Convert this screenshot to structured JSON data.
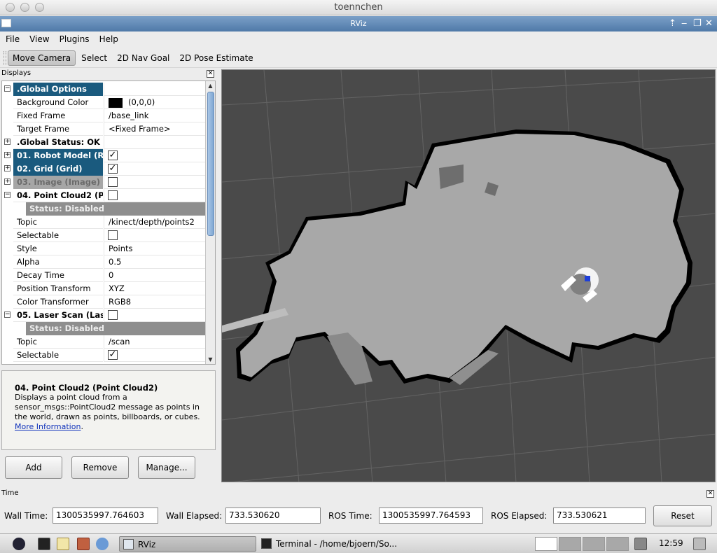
{
  "outer_window": {
    "title": "toennchen"
  },
  "window": {
    "title": "RViz"
  },
  "menu": [
    "File",
    "View",
    "Plugins",
    "Help"
  ],
  "toolbar": {
    "tools": [
      "Move Camera",
      "Select",
      "2D Nav Goal",
      "2D Pose Estimate"
    ],
    "active": "Move Camera"
  },
  "displays_panel": {
    "title": "Displays",
    "rows": [
      {
        "name": ".Global Options",
        "type": "category",
        "expand": "minus"
      },
      {
        "name": "Background Color",
        "value": "(0,0,0)",
        "type": "prop",
        "swatch": "#000000"
      },
      {
        "name": "Fixed Frame",
        "value": "/base_link",
        "type": "prop"
      },
      {
        "name": "Target Frame",
        "value": "<Fixed Frame>",
        "type": "prop"
      },
      {
        "name": ".Global Status: OK",
        "type": "bold",
        "expand": "plus"
      },
      {
        "name": "01. Robot Model (R",
        "type": "category",
        "expand": "plus",
        "checked": true
      },
      {
        "name": "02. Grid (Grid)",
        "type": "category",
        "expand": "plus",
        "checked": true
      },
      {
        "name": "03. Image (Image)",
        "type": "dim",
        "expand": "plus",
        "checked": false
      },
      {
        "name": "04. Point Cloud2 (P",
        "type": "bold",
        "expand": "minus",
        "checked": false
      },
      {
        "name": "Status: Disabled",
        "type": "status"
      },
      {
        "name": "Topic",
        "value": "/kinect/depth/points2",
        "type": "prop"
      },
      {
        "name": "Selectable",
        "type": "prop",
        "checked": false
      },
      {
        "name": "Style",
        "value": "Points",
        "type": "prop"
      },
      {
        "name": "Alpha",
        "value": "0.5",
        "type": "prop"
      },
      {
        "name": "Decay Time",
        "value": "0",
        "type": "prop"
      },
      {
        "name": "Position Transform",
        "value": "XYZ",
        "type": "prop"
      },
      {
        "name": "Color Transformer",
        "value": "RGB8",
        "type": "prop"
      },
      {
        "name": "05. Laser Scan (Las",
        "type": "bold",
        "expand": "minus",
        "checked": false
      },
      {
        "name": "Status: Disabled",
        "type": "status"
      },
      {
        "name": "Topic",
        "value": "/scan",
        "type": "prop"
      },
      {
        "name": "Selectable",
        "type": "prop",
        "checked": true
      }
    ]
  },
  "description": {
    "title": "04. Point Cloud2 (Point Cloud2)",
    "text": "Displays a point cloud from a sensor_msgs::PointCloud2 message as points in the world, drawn as points, billboards, or cubes.",
    "link": "More Information",
    "after_link": "."
  },
  "buttons": {
    "add": "Add",
    "remove": "Remove",
    "manage": "Manage..."
  },
  "time_panel": {
    "title": "Time",
    "wall_time_label": "Wall Time:",
    "wall_time": "1300535997.764603",
    "wall_elapsed_label": "Wall Elapsed:",
    "wall_elapsed": "733.530620",
    "ros_time_label": "ROS Time:",
    "ros_time": "1300535997.764593",
    "ros_elapsed_label": "ROS Elapsed:",
    "ros_elapsed": "733.530621",
    "reset": "Reset"
  },
  "taskbar": {
    "tasks": [
      "RViz",
      "Terminal - /home/bjoern/So..."
    ],
    "clock": "12:59"
  },
  "colors": {
    "category_bg": "#1a5a7e",
    "map_free": "#a6a6a6",
    "map_unknown": "#4a4a4a",
    "map_occupied": "#000000"
  },
  "icons": [
    "close-icon",
    "expand-icon",
    "checkbox-icon",
    "terminal-icon",
    "editor-icon",
    "globe-icon",
    "speaker-icon"
  ]
}
